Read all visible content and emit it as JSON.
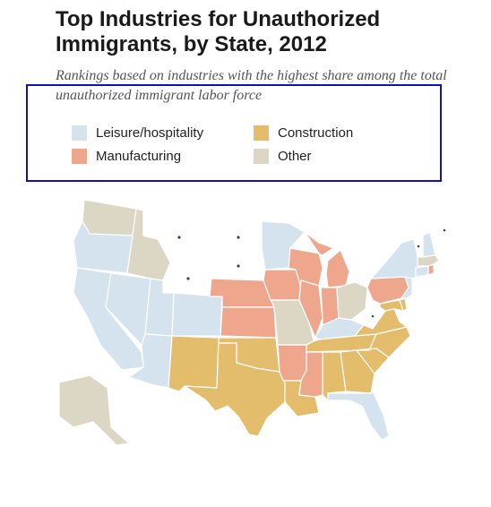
{
  "title": "Top Industries for Unauthorized Immigrants, by State, 2012",
  "subtitle": "Rankings based on industries with the highest share among the total unauthorized immigrant labor force",
  "legend": [
    {
      "key": "leisure",
      "label": "Leisure/hospitality",
      "color": "#d4e3ee"
    },
    {
      "key": "construction",
      "label": "Construction",
      "color": "#e3bd6c"
    },
    {
      "key": "manufacturing",
      "label": "Manufacturing",
      "color": "#eea78c"
    },
    {
      "key": "other",
      "label": "Other",
      "color": "#dcd6c5"
    }
  ],
  "no_data_color": "#ffffff",
  "states": {
    "WA": "other",
    "OR": "leisure",
    "CA": "leisure",
    "NV": "leisure",
    "ID": "other",
    "MT": "none",
    "WY": "none",
    "UT": "leisure",
    "AZ": "leisure",
    "CO": "leisure",
    "NM": "construction",
    "ND": "none",
    "SD": "none",
    "NE": "manufacturing",
    "KS": "manufacturing",
    "OK": "construction",
    "TX": "construction",
    "MN": "leisure",
    "IA": "manufacturing",
    "MO": "other",
    "AR": "manufacturing",
    "LA": "construction",
    "WI": "manufacturing",
    "IL": "manufacturing",
    "MI": "manufacturing",
    "IN": "manufacturing",
    "OH": "other",
    "KY": "leisure",
    "TN": "construction",
    "MS": "manufacturing",
    "AL": "construction",
    "GA": "construction",
    "FL": "leisure",
    "SC": "construction",
    "NC": "construction",
    "VA": "construction",
    "WV": "none",
    "MD": "construction",
    "DE": "construction",
    "PA": "manufacturing",
    "NJ": "leisure",
    "NY": "leisure",
    "CT": "leisure",
    "RI": "manufacturing",
    "MA": "other",
    "VT": "none",
    "NH": "leisure",
    "ME": "none",
    "AK": "other",
    "HI": "leisure"
  }
}
